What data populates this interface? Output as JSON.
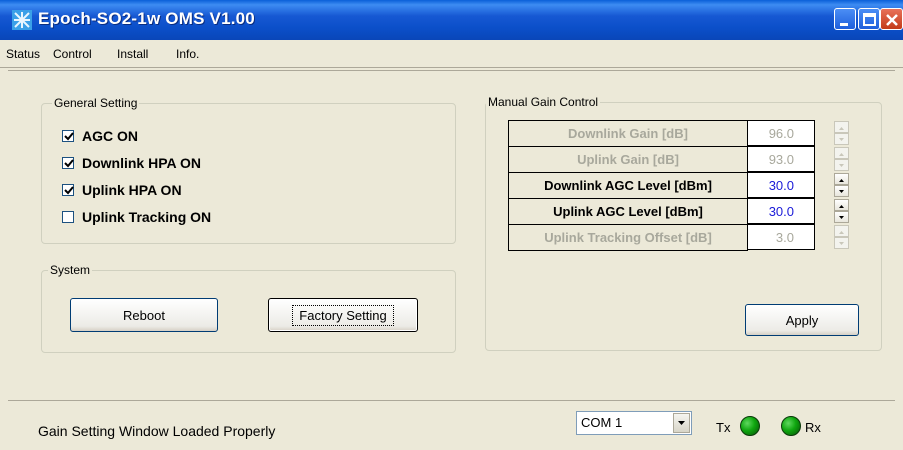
{
  "window": {
    "title": "Epoch-SO2-1w OMS V1.00"
  },
  "menu": {
    "items": [
      "Status",
      "Control",
      "Install",
      "Info."
    ]
  },
  "general_setting": {
    "label": "General Setting",
    "options": [
      {
        "label": "AGC ON",
        "checked": true
      },
      {
        "label": "Downlink HPA ON",
        "checked": true
      },
      {
        "label": "Uplink HPA ON",
        "checked": true
      },
      {
        "label": "Uplink Tracking ON",
        "checked": false
      }
    ]
  },
  "system": {
    "label": "System",
    "reboot_label": "Reboot",
    "factory_label": "Factory Setting"
  },
  "manual_gain": {
    "label": "Manual Gain Control",
    "rows": [
      {
        "label": "Downlink Gain [dB]",
        "value": "96.0",
        "enabled": false
      },
      {
        "label": "Uplink Gain [dB]",
        "value": "93.0",
        "enabled": false
      },
      {
        "label": "Downlink AGC Level [dBm]",
        "value": "30.0",
        "enabled": true
      },
      {
        "label": "Uplink AGC Level [dBm]",
        "value": "30.0",
        "enabled": true
      },
      {
        "label": "Uplink Tracking Offset [dB]",
        "value": "3.0",
        "enabled": false
      }
    ],
    "apply_label": "Apply"
  },
  "status": {
    "message": "Gain Setting Window Loaded Properly",
    "port": "COM 1",
    "tx_label": "Tx",
    "rx_label": "Rx"
  },
  "colors": {
    "titlebar": "#0b4fc9",
    "enabled_value": "#1a1ad8",
    "disabled_text": "#a8a89c",
    "led": "#0fa60f"
  },
  "icons": [
    "app-icon",
    "minimize-icon",
    "maximize-icon",
    "close-icon",
    "checkmark-icon",
    "spin-up-icon",
    "spin-down-icon",
    "dropdown-arrow-icon",
    "tx-led-icon",
    "rx-led-icon"
  ]
}
